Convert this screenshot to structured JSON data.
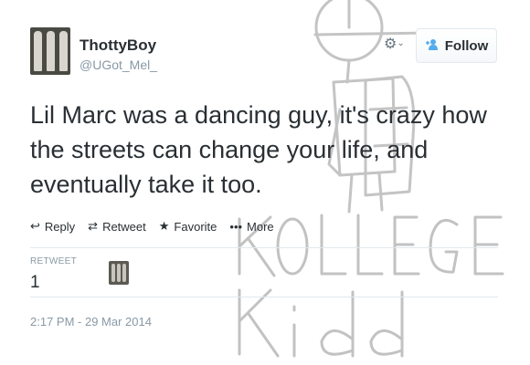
{
  "user": {
    "name": "ThottyBoy",
    "handle": "@UGot_Mel_"
  },
  "follow_button": {
    "label": "Follow",
    "icon": "add-person-icon"
  },
  "settings_icon": "gear-icon",
  "tweet": {
    "lines": [
      "Lil Marc was a dancing guy, it's crazy how",
      "the streets can change your life, and",
      "eventually take it too."
    ]
  },
  "actions": [
    {
      "label": "Reply",
      "icon": "reply-icon"
    },
    {
      "label": "Retweet",
      "icon": "retweet-icon"
    },
    {
      "label": "Favorite",
      "icon": "star-icon"
    },
    {
      "label": "More",
      "icon": "more-icon"
    }
  ],
  "stats": {
    "retweet_label": "RETWEET",
    "retweet_count": "1"
  },
  "timestamp": "2:17 PM - 29 Mar 2014",
  "watermark": {
    "line1": "KOLLEGE",
    "line2": "Kidd"
  },
  "colors": {
    "text": "#292f33",
    "muted": "#8899a6",
    "accent": "#55acee",
    "border": "#e1e8ed"
  }
}
